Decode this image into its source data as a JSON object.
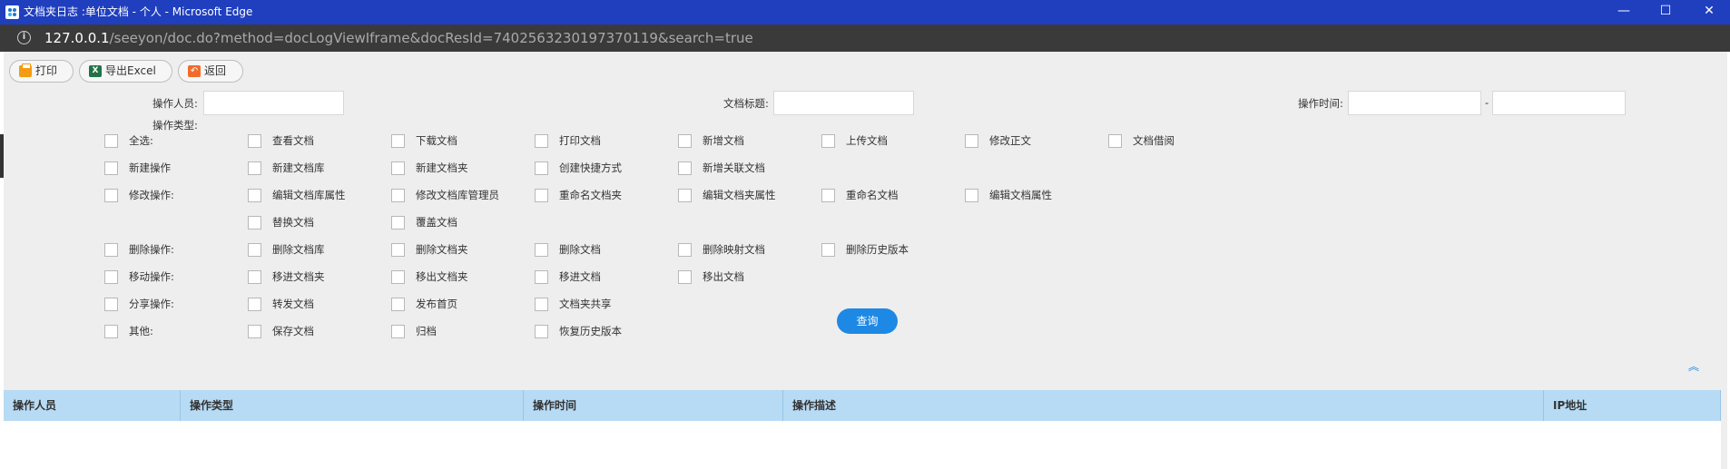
{
  "window": {
    "title": "文档夹日志 :单位文档 - 个人 - Microsoft Edge",
    "minimize": "—",
    "maximize": "☐",
    "close": "✕"
  },
  "address": {
    "host": "127.0.0.1",
    "path": "/seeyon/doc.do?method=docLogViewIframe&docResId=7402563230197370119&search=true"
  },
  "toolbar": {
    "print_label": "打印",
    "export_label": "导出Excel",
    "back_label": "返回"
  },
  "filters": {
    "operator_label": "操作人员:",
    "operator_value": "",
    "doc_title_label": "文档标题:",
    "doc_title_value": "",
    "op_time_label": "操作时间:",
    "op_time_start": "",
    "op_time_sep": "-",
    "op_time_end": "",
    "op_type_label": "操作类型:"
  },
  "checkbox_rows": [
    [
      "全选:",
      "查看文档",
      "下载文档",
      "打印文档",
      "新增文档",
      "上传文档",
      "修改正文",
      "文档借阅"
    ],
    [
      "新建操作",
      "新建文档库",
      "新建文档夹",
      "创建快捷方式",
      "新增关联文档"
    ],
    [
      "修改操作:",
      "编辑文档库属性",
      "修改文档库管理员",
      "重命名文档夹",
      "编辑文档夹属性",
      "重命名文档",
      "编辑文档属性"
    ],
    [
      "",
      "替换文档",
      "覆盖文档"
    ],
    [
      "删除操作:",
      "删除文档库",
      "删除文档夹",
      "删除文档",
      "删除映射文档",
      "删除历史版本"
    ],
    [
      "移动操作:",
      "移进文档夹",
      "移出文档夹",
      "移进文档",
      "移出文档"
    ],
    [
      "分享操作:",
      "转发文档",
      "发布首页",
      "文档夹共享"
    ],
    [
      "其他:",
      "保存文档",
      "归档",
      "恢复历史版本"
    ]
  ],
  "query_label": "查询",
  "table": {
    "headers": [
      "操作人员",
      "操作类型",
      "操作时间",
      "操作描述",
      "IP地址"
    ],
    "rows": []
  }
}
